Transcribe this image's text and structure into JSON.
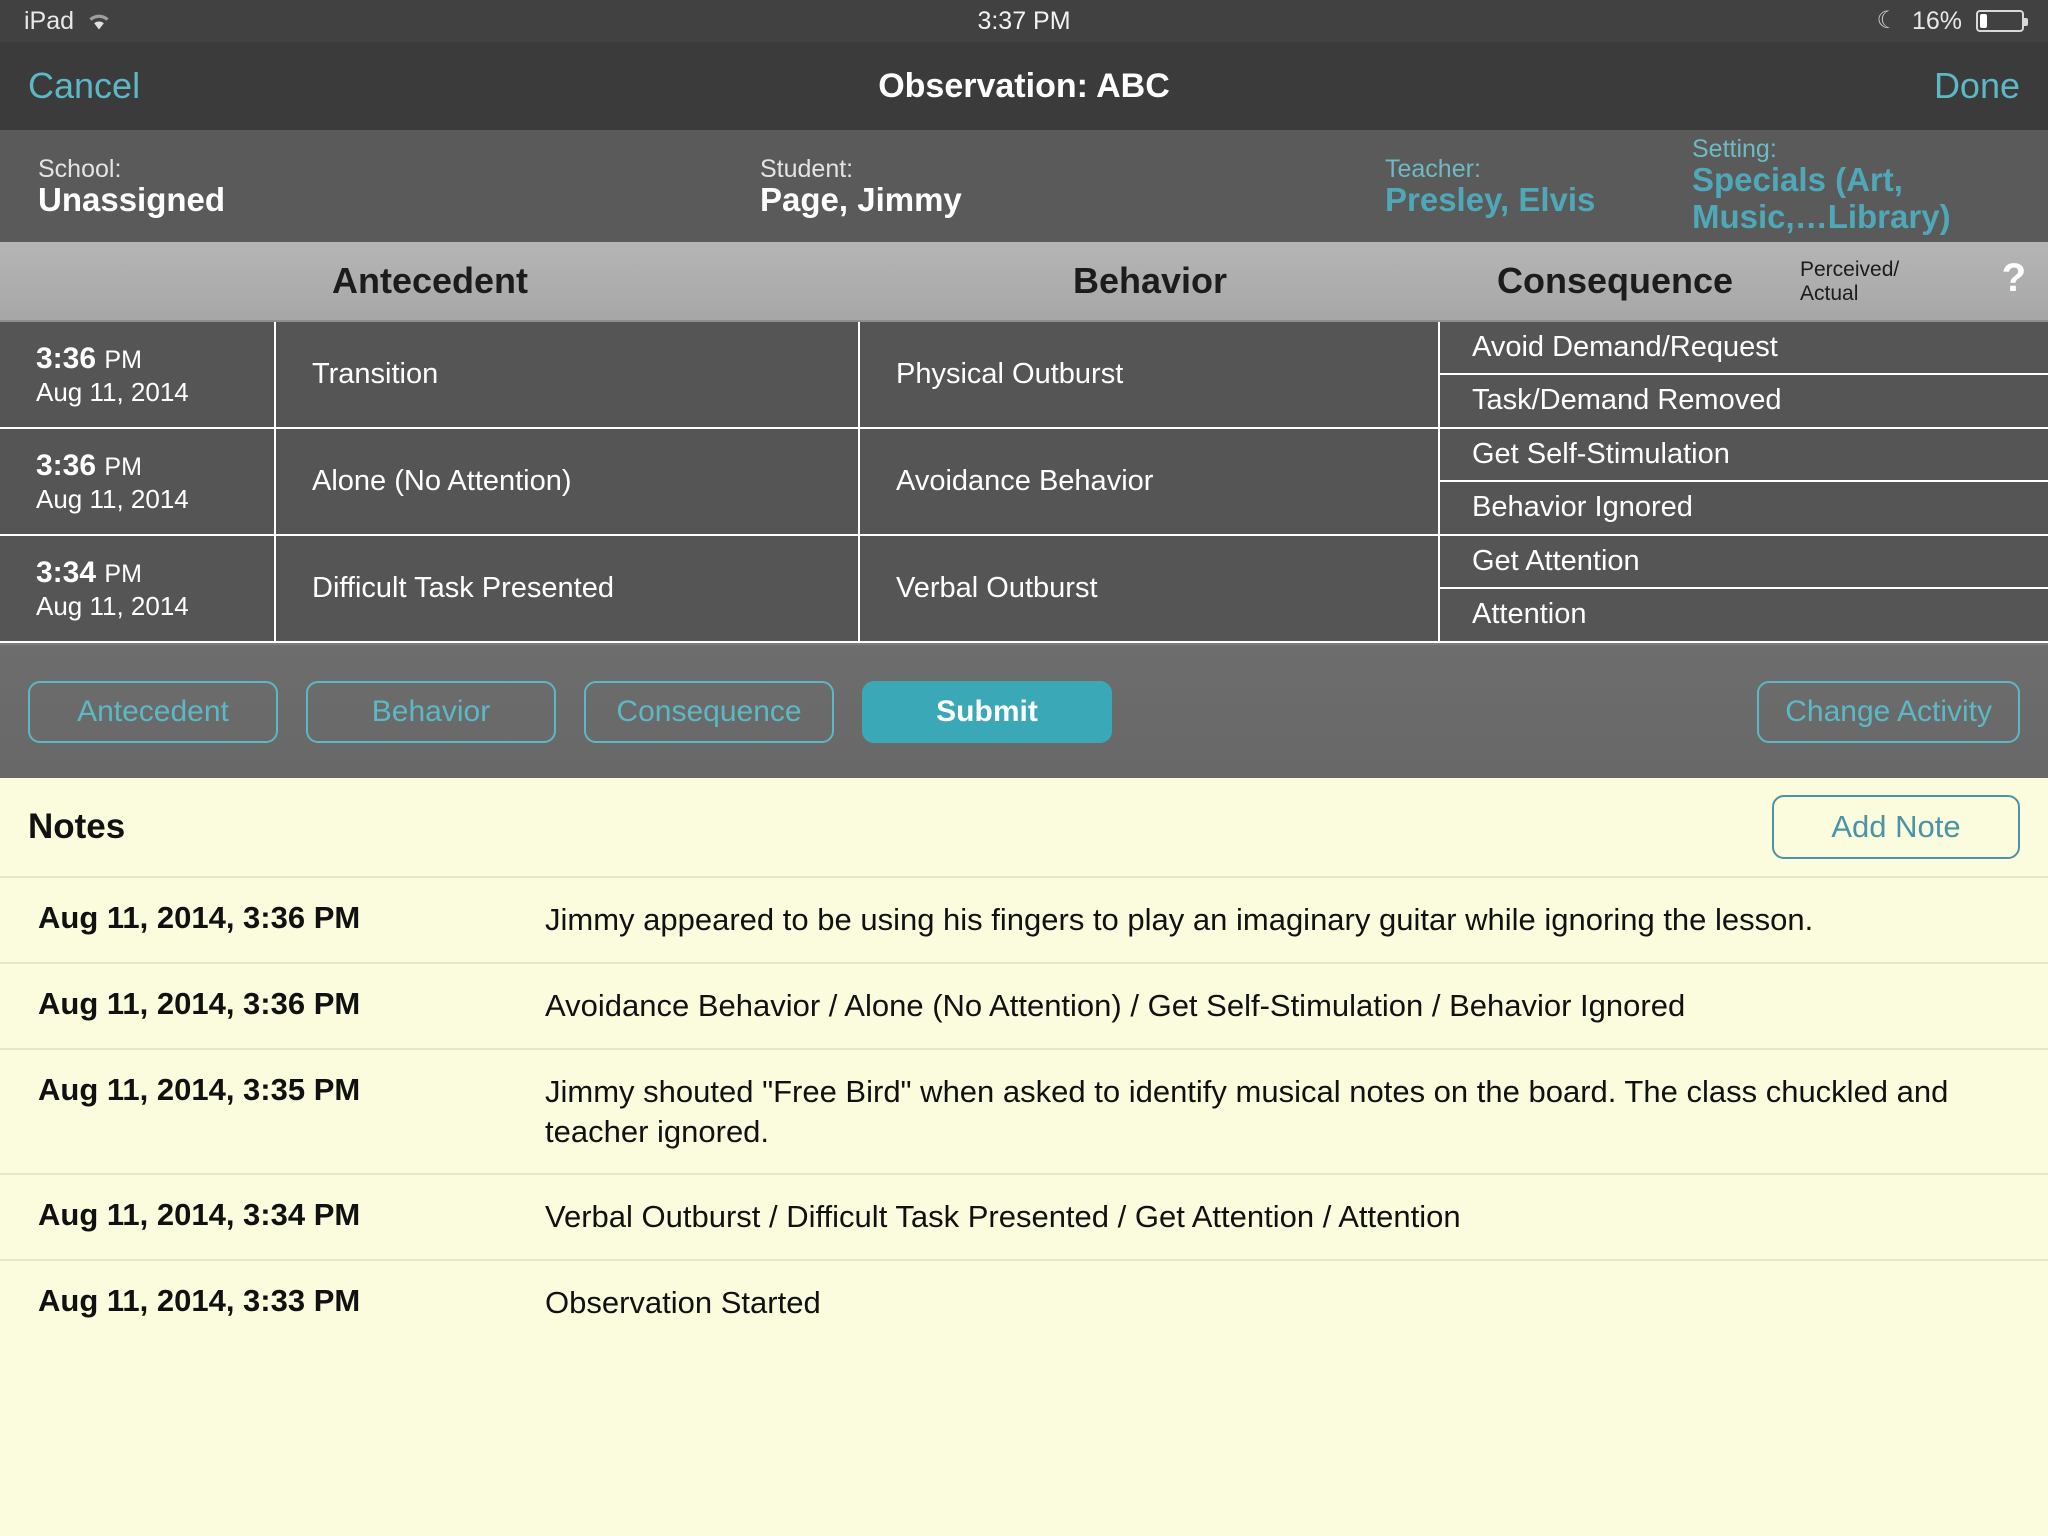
{
  "status_bar": {
    "device": "iPad",
    "wifi_icon": "wifi-icon",
    "time": "3:37 PM",
    "dnd_icon": "moon-icon",
    "battery_percent": "16%",
    "battery_level": 16
  },
  "nav": {
    "cancel_label": "Cancel",
    "title": "Observation: ABC",
    "done_label": "Done"
  },
  "info": {
    "school_label": "School:",
    "school_value": "Unassigned",
    "student_label": "Student:",
    "student_value": "Page, Jimmy",
    "teacher_label": "Teacher:",
    "teacher_value": "Presley, Elvis",
    "setting_label": "Setting:",
    "setting_value": "Specials (Art, Music,…Library)"
  },
  "table": {
    "headers": {
      "antecedent": "Antecedent",
      "behavior": "Behavior",
      "consequence": "Consequence",
      "perceived_actual": "Perceived/\nActual",
      "help_icon": "?"
    },
    "rows": [
      {
        "time": "3:36",
        "ampm": "PM",
        "date": "Aug 11, 2014",
        "antecedent": "Transition",
        "behavior": "Physical Outburst",
        "consequence_perceived": "Avoid Demand/Request",
        "consequence_actual": "Task/Demand Removed"
      },
      {
        "time": "3:36",
        "ampm": "PM",
        "date": "Aug 11, 2014",
        "antecedent": "Alone (No Attention)",
        "behavior": "Avoidance Behavior",
        "consequence_perceived": "Get Self-Stimulation",
        "consequence_actual": "Behavior Ignored"
      },
      {
        "time": "3:34",
        "ampm": "PM",
        "date": "Aug 11, 2014",
        "antecedent": "Difficult Task Presented",
        "behavior": "Verbal Outburst",
        "consequence_perceived": "Get Attention",
        "consequence_actual": "Attention"
      }
    ]
  },
  "actions": {
    "antecedent_label": "Antecedent",
    "behavior_label": "Behavior",
    "consequence_label": "Consequence",
    "submit_label": "Submit",
    "change_activity_label": "Change Activity",
    "accent_color": "#5bb8c4",
    "submit_fill_color": "#3ba8b8"
  },
  "notes": {
    "title": "Notes",
    "add_note_label": "Add Note",
    "background_color": "#fbfbdd",
    "items": [
      {
        "timestamp": "Aug 11, 2014, 3:36 PM",
        "text": "Jimmy appeared to be using his fingers to play an imaginary guitar while ignoring the lesson."
      },
      {
        "timestamp": "Aug 11, 2014, 3:36 PM",
        "text": "Avoidance Behavior / Alone (No Attention) / Get Self-Stimulation / Behavior Ignored"
      },
      {
        "timestamp": "Aug 11, 2014, 3:35 PM",
        "text": "Jimmy shouted \"Free Bird\" when asked to identify musical notes on the board. The class chuckled and teacher ignored."
      },
      {
        "timestamp": "Aug 11, 2014, 3:34 PM",
        "text": "Verbal Outburst / Difficult Task Presented / Get Attention / Attention"
      },
      {
        "timestamp": "Aug 11, 2014, 3:33 PM",
        "text": "Observation Started"
      }
    ]
  }
}
